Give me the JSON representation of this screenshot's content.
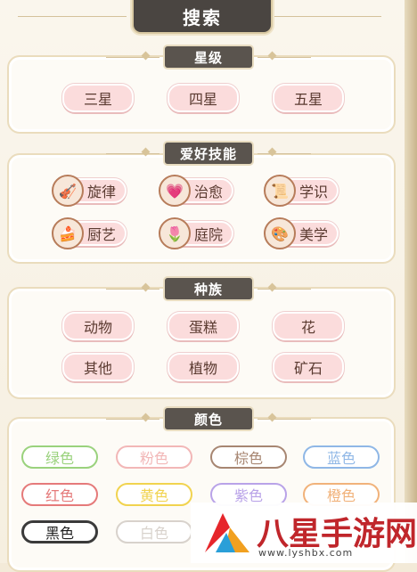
{
  "header": {
    "title": "搜索"
  },
  "sections": {
    "star": {
      "title": "星级",
      "items": [
        "三星",
        "四星",
        "五星"
      ]
    },
    "hobby": {
      "title": "爱好技能",
      "items": [
        {
          "label": "旋律",
          "icon": "melody-icon"
        },
        {
          "label": "治愈",
          "icon": "healing-icon"
        },
        {
          "label": "学识",
          "icon": "knowledge-icon"
        },
        {
          "label": "厨艺",
          "icon": "cooking-icon"
        },
        {
          "label": "庭院",
          "icon": "garden-icon"
        },
        {
          "label": "美学",
          "icon": "aesthetics-icon"
        }
      ]
    },
    "race": {
      "title": "种族",
      "items": [
        "动物",
        "蛋糕",
        "花",
        "其他",
        "植物",
        "矿石"
      ]
    },
    "color": {
      "title": "颜色",
      "items": [
        {
          "label": "绿色",
          "color": "#9ad27d"
        },
        {
          "label": "粉色",
          "color": "#f2b7b7"
        },
        {
          "label": "棕色",
          "color": "#a78672"
        },
        {
          "label": "蓝色",
          "color": "#8fb7e6"
        },
        {
          "label": "红色",
          "color": "#e57a7a"
        },
        {
          "label": "黄色",
          "color": "#f1d34f"
        },
        {
          "label": "紫色",
          "color": "#b9a3e8"
        },
        {
          "label": "橙色",
          "color": "#f1b27a"
        },
        {
          "label": "黑色",
          "color": "#3a3a3a"
        },
        {
          "label": "白色",
          "color": "#d8d2cc"
        }
      ]
    }
  },
  "watermark": {
    "text": "八星手游网",
    "url": "www.lyshbx.com"
  }
}
